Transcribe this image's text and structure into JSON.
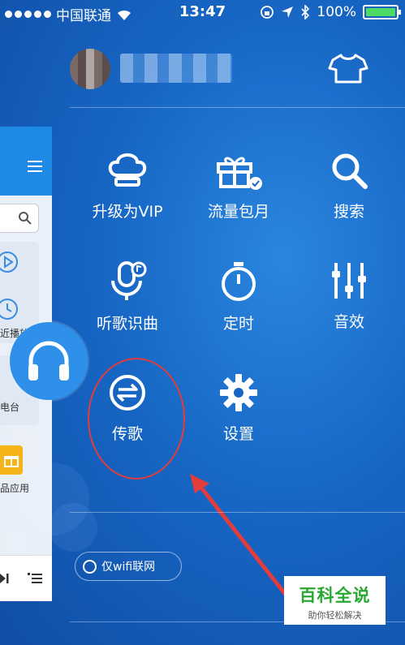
{
  "status_bar": {
    "carrier": "中国联通",
    "time": "13:47",
    "battery": "100%",
    "battery_color": "#4cd964"
  },
  "profile": {
    "avatar_icon": "avatar",
    "skin_icon": "tshirt-icon"
  },
  "menu": {
    "items": [
      {
        "label": "升级为VIP",
        "icon": "crown-icon"
      },
      {
        "label": "流量包月",
        "icon": "gift-box-icon"
      },
      {
        "label": "搜索",
        "icon": "search-icon"
      },
      {
        "label": "听歌识曲",
        "icon": "microphone-icon"
      },
      {
        "label": "定时",
        "icon": "timer-icon"
      },
      {
        "label": "音效",
        "icon": "equalizer-icon"
      },
      {
        "label": "传歌",
        "icon": "transfer-icon"
      },
      {
        "label": "设置",
        "icon": "gear-icon"
      }
    ]
  },
  "side_panel": {
    "labels": [
      "近播放",
      "电台",
      "品应用"
    ]
  },
  "wifi_toggle": {
    "label": "仅wifi联网"
  },
  "watermark": {
    "title": "百科全说",
    "subtitle": "助你轻松解决"
  },
  "colors": {
    "background": "#1766c4",
    "annotation": "#e23c3c",
    "accent_blue": "#2e90e8"
  }
}
